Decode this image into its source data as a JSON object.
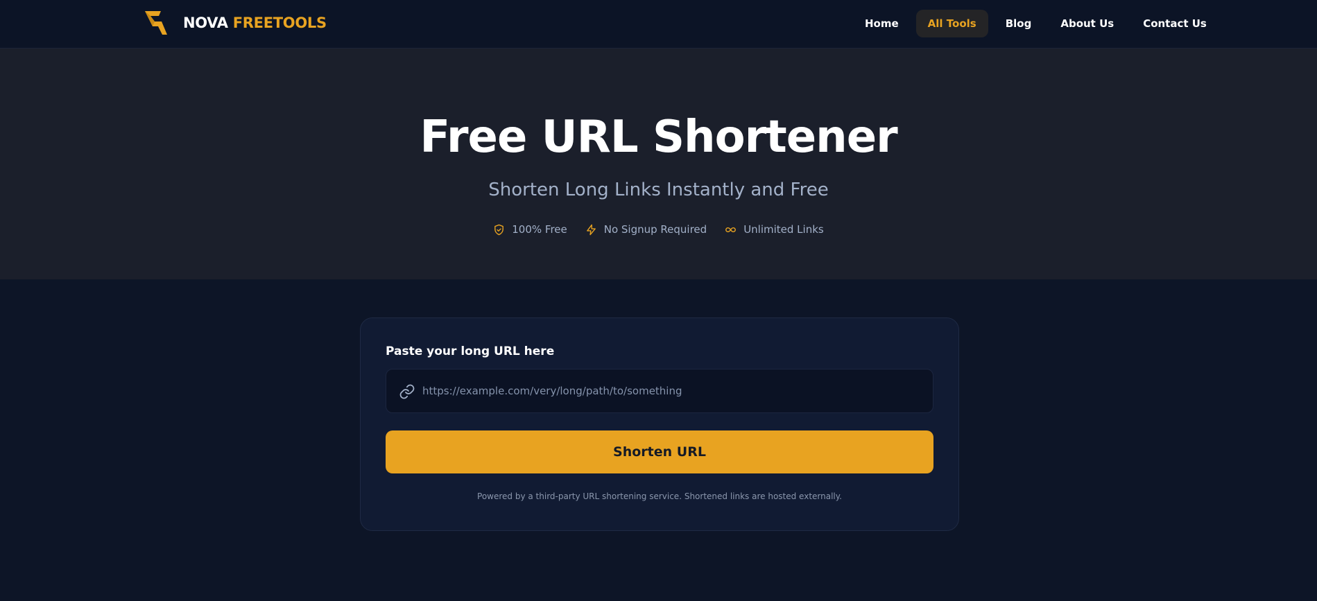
{
  "brand": {
    "name_part1": "NOVA",
    "name_part2": "FREETOOLS",
    "icon": "lightning-logo-icon"
  },
  "nav": {
    "items": [
      {
        "label": "Home",
        "active": false
      },
      {
        "label": "All Tools",
        "active": true
      },
      {
        "label": "Blog",
        "active": false
      },
      {
        "label": "About Us",
        "active": false
      },
      {
        "label": "Contact Us",
        "active": false
      }
    ]
  },
  "hero": {
    "title": "Free URL Shortener",
    "subtitle": "Shorten Long Links Instantly and Free",
    "features": [
      {
        "icon": "shield-check-icon",
        "label": "100% Free"
      },
      {
        "icon": "bolt-icon",
        "label": "No Signup Required"
      },
      {
        "icon": "infinity-icon",
        "label": "Unlimited Links"
      }
    ]
  },
  "form": {
    "label": "Paste your long URL here",
    "input_icon": "link-icon",
    "input_value": "",
    "input_placeholder": "https://example.com/very/long/path/to/something",
    "button_label": "Shorten URL",
    "footnote": "Powered by a third-party URL shortening service. Shortened links are hosted externally."
  },
  "colors": {
    "accent": "#e8a321",
    "page_bg": "#0d1527",
    "hero_bg": "#1b1f2b",
    "card_bg": "#111b33"
  }
}
